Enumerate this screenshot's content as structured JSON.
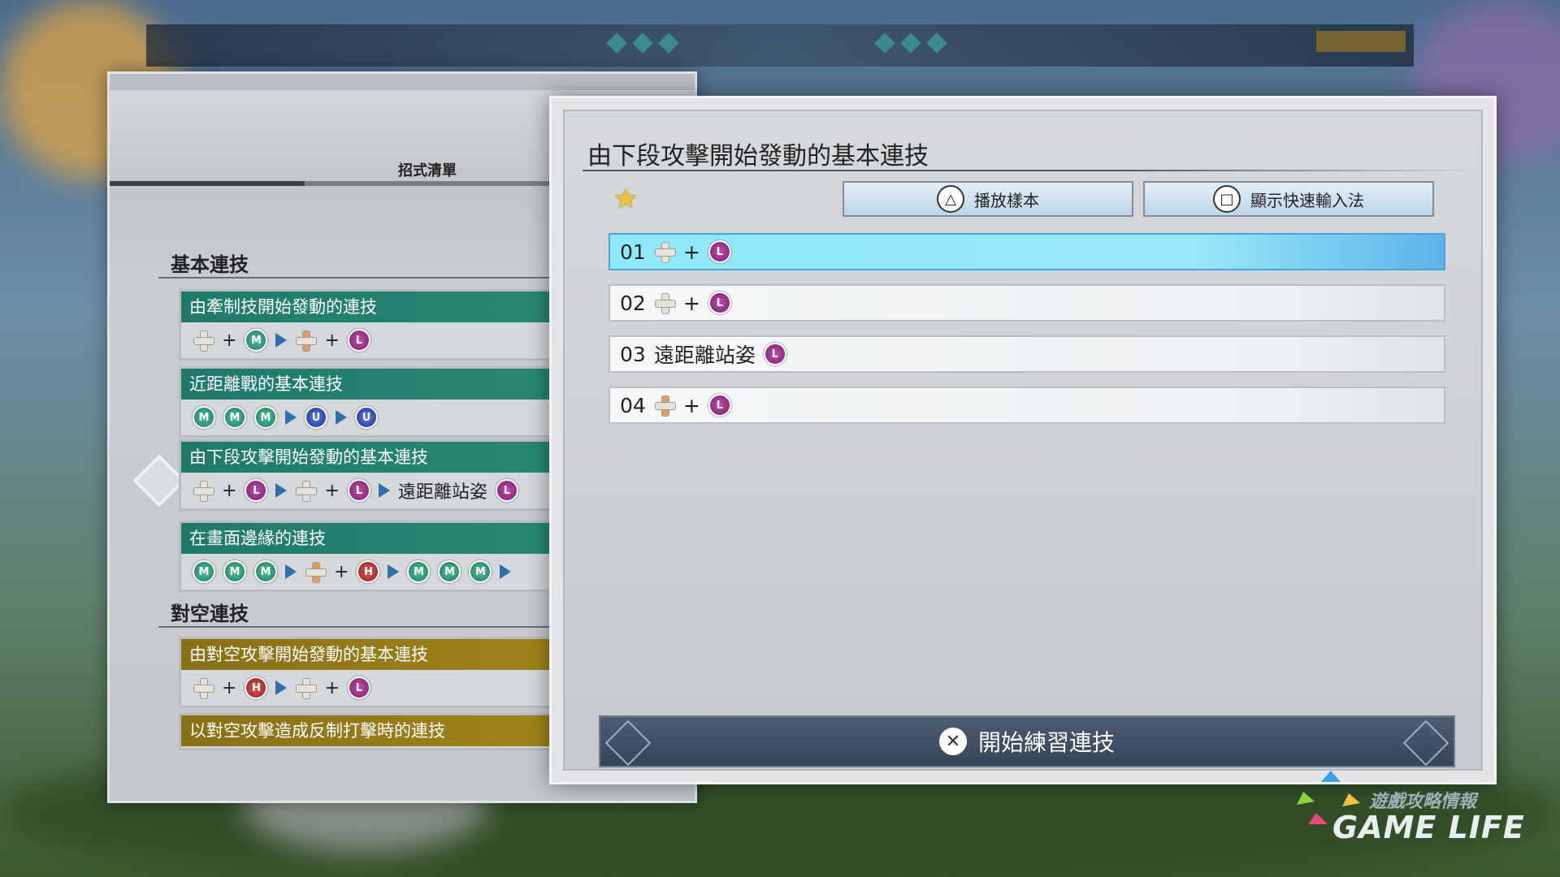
{
  "background": {
    "colors": {
      "sky": "#5e7f9e",
      "grass": "#3d5a2f"
    }
  },
  "left_panel": {
    "tab_label": "招式清單",
    "sections": [
      {
        "title": "基本連技",
        "cards": [
          {
            "title": "由牽制技開始發動的連技",
            "style": "teal",
            "tail_text": ""
          },
          {
            "title": "近距離戰的基本連技",
            "style": "teal",
            "tail_text": ""
          },
          {
            "title": "由下段攻擊開始發動的基本連技",
            "style": "teal",
            "tail_text": "遠距離站姿"
          },
          {
            "title": "在畫面邊緣的連技",
            "style": "teal",
            "tail_text": ""
          }
        ]
      },
      {
        "title": "對空連技",
        "cards": [
          {
            "title": "由對空攻擊開始發動的基本連技",
            "style": "gold",
            "tail_text": ""
          },
          {
            "title": "以對空攻擊造成反制打擊時的連技",
            "style": "gold",
            "tail_text": ""
          }
        ]
      }
    ]
  },
  "dialog": {
    "title": "由下段攻擊開始發動的基本連技",
    "favorite_icon": "star-icon",
    "buttons": {
      "play_sample": "播放樣本",
      "show_quick_input": "顯示快速輸入法"
    },
    "steps": [
      {
        "num": "01",
        "text": "",
        "selected": true
      },
      {
        "num": "02",
        "text": "",
        "selected": false
      },
      {
        "num": "03",
        "text": "遠距離站姿",
        "selected": false
      },
      {
        "num": "04",
        "text": "",
        "selected": false
      }
    ],
    "start_label": "開始練習連技"
  },
  "glyphs": {
    "plus": "+",
    "L": "L",
    "M": "M",
    "H": "H",
    "U": "U",
    "triangle": "△",
    "square": "□",
    "cross": "✕",
    "star": "★"
  },
  "watermark": {
    "sub": "遊戲攻略情報",
    "main": "GAME LIFE"
  }
}
